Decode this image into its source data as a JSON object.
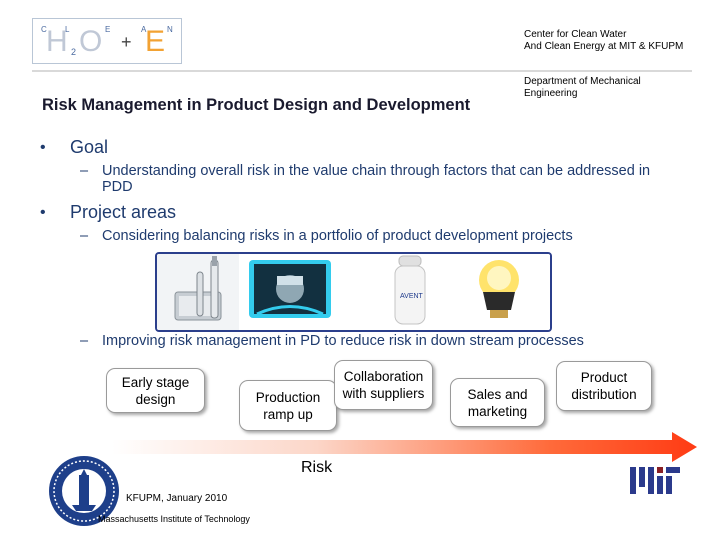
{
  "logo": {
    "letters_top": [
      "C",
      "L",
      "E",
      "A",
      "N"
    ],
    "h": "H",
    "sub": "2",
    "o": "O",
    "plus": "+",
    "e": "E"
  },
  "header": {
    "center_line1": "Center for Clean Water",
    "center_line2": "And Clean Energy at MIT & KFUPM",
    "dept_line1": "Department of Mechanical",
    "dept_line2": "Engineering"
  },
  "title": "Risk Management in Product Design and Development",
  "bullets": [
    {
      "label": "Goal",
      "sub": "Understanding overall risk in the value chain through factors that can be addressed in PDD"
    },
    {
      "label": "Project areas",
      "sub": "Considering balancing risks in a portfolio of product development projects"
    }
  ],
  "products": {
    "bottle_label": "AVENT"
  },
  "sub_bullet3": "Improving risk management in PD to reduce risk in down stream processes",
  "process": {
    "early_stage": "Early stage\ndesign",
    "production": "Production\nramp up",
    "collaboration": "Collaboration\nwith suppliers",
    "sales": "Sales and\nmarketing",
    "distribution": "Product\ndistribution"
  },
  "risk_label": "Risk",
  "footer": {
    "date": "KFUPM, January 2010",
    "institute": "Massachusetts Institute of Technology"
  },
  "colors": {
    "bullet_text": "#1f3b6e",
    "strip_border": "#2b3f8c",
    "arrow_start": "#ffffff",
    "arrow_end": "#ff3b14",
    "mit_logo": "#2b3a8c"
  }
}
